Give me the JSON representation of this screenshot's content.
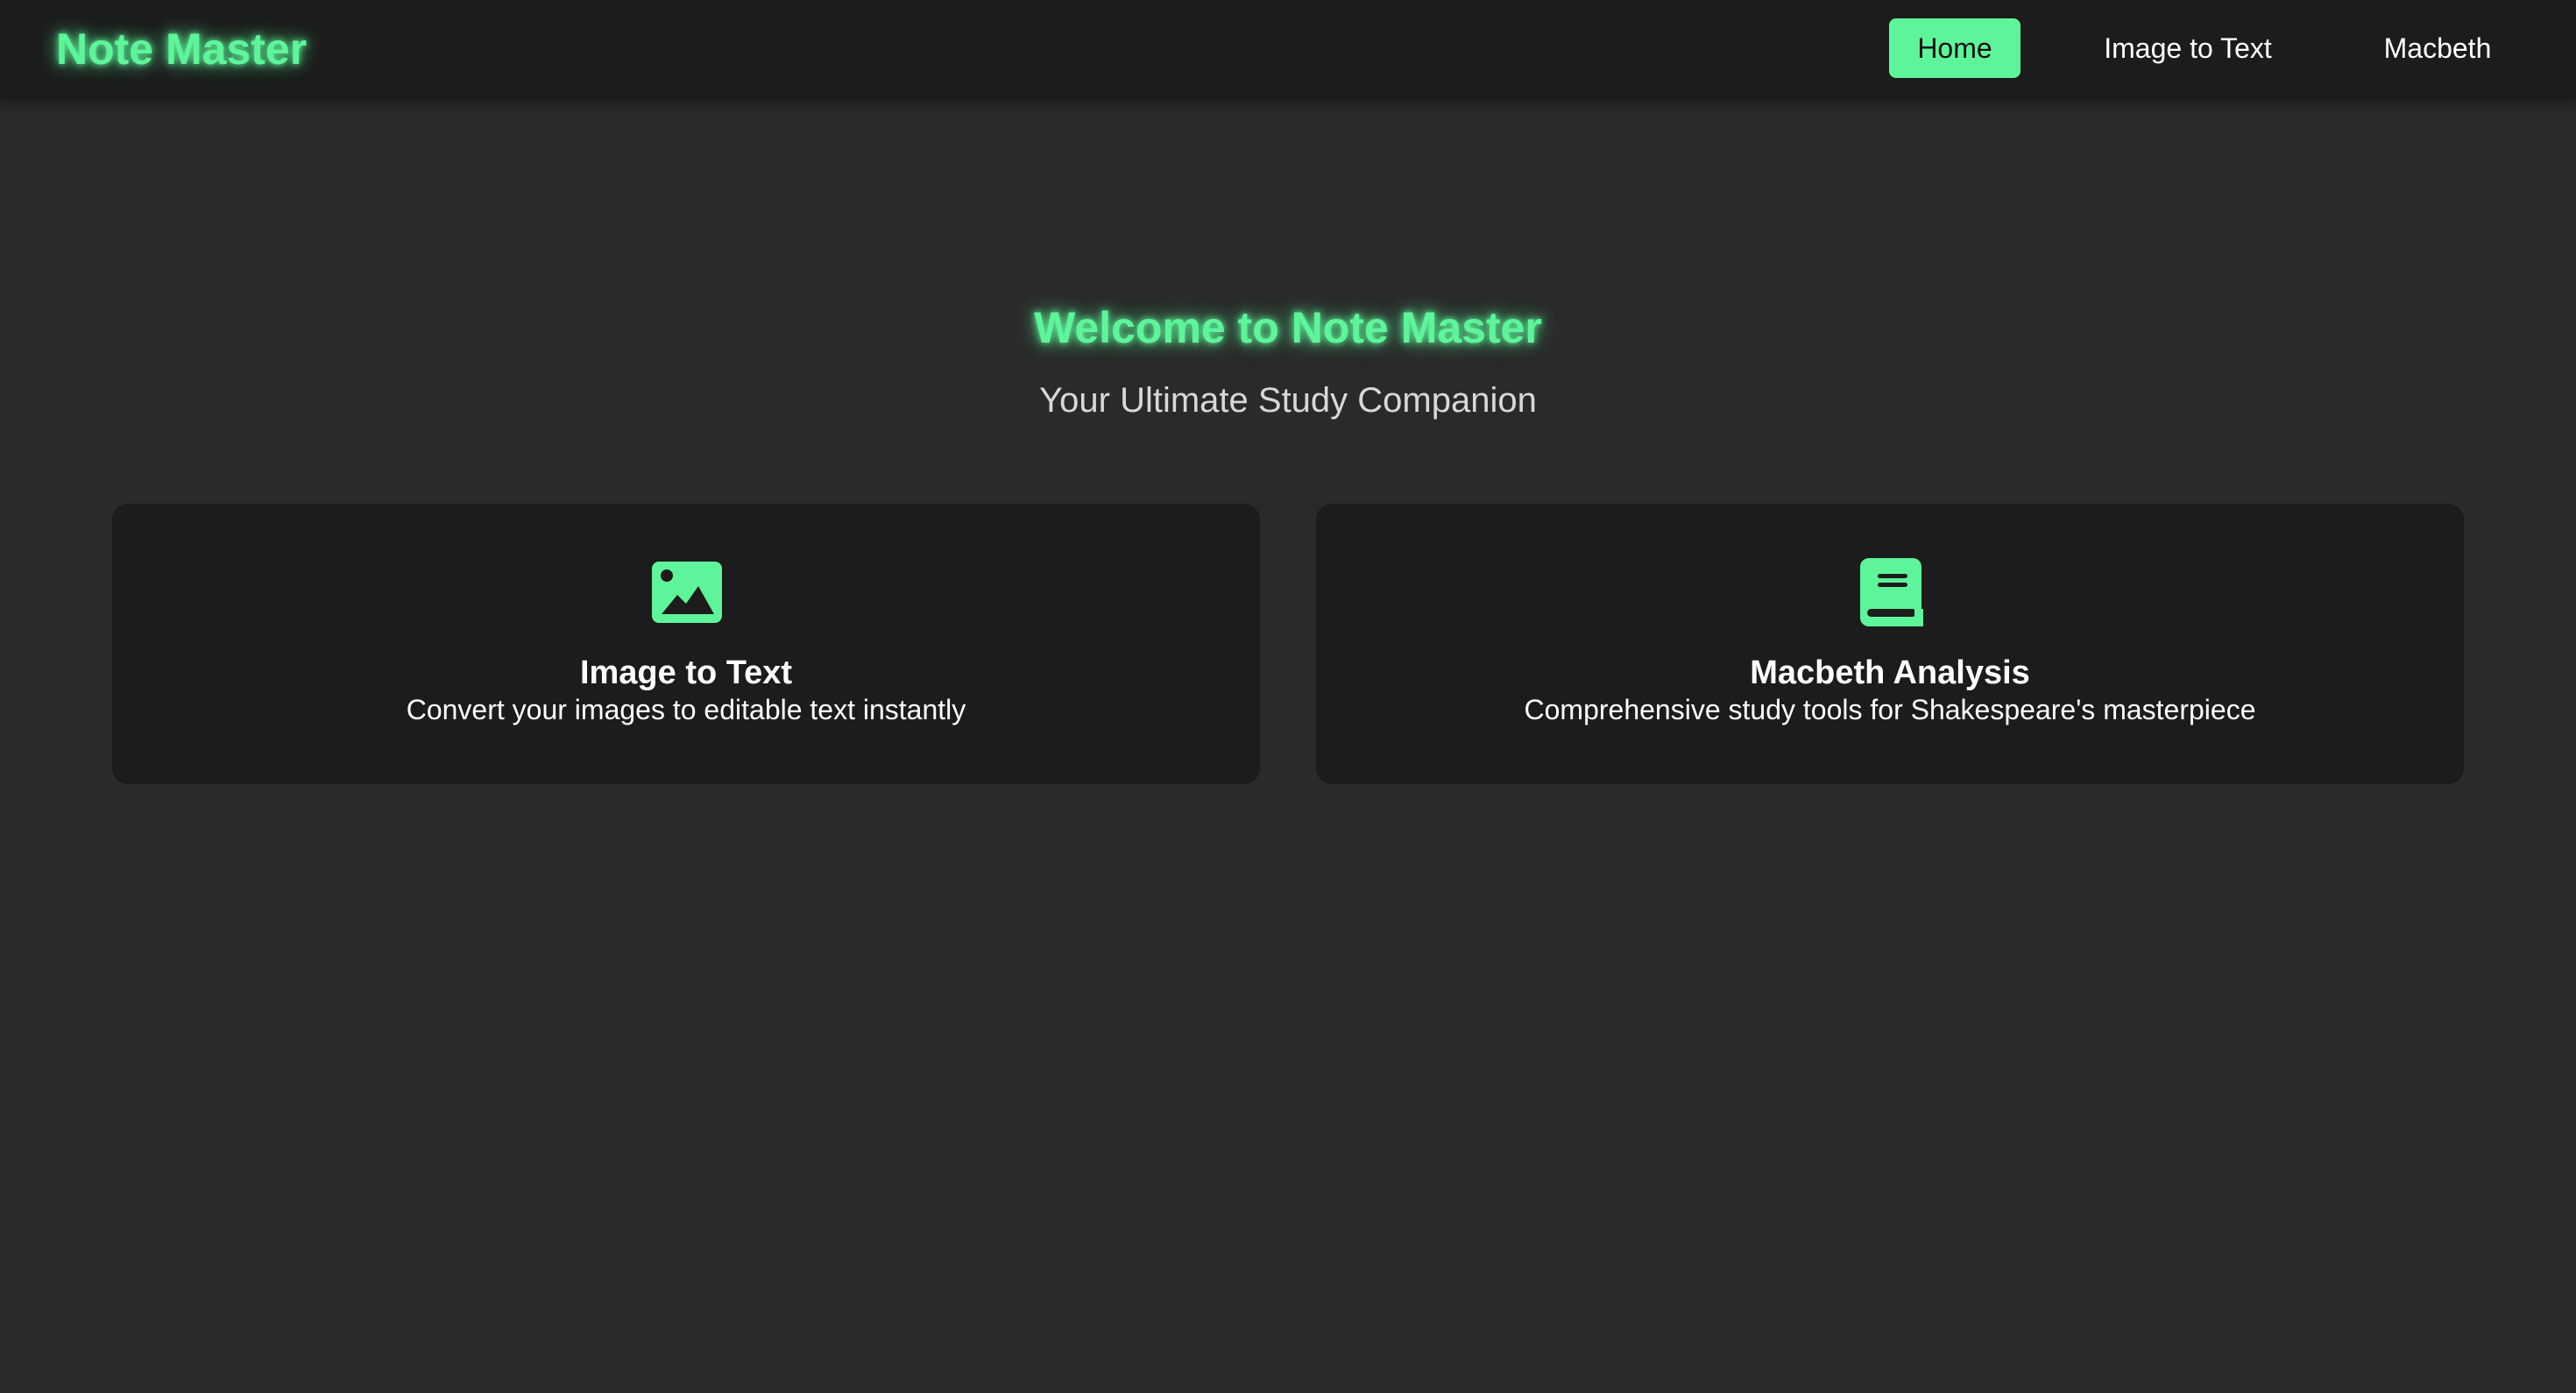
{
  "header": {
    "logo": "Note Master",
    "nav": [
      {
        "label": "Home",
        "active": true
      },
      {
        "label": "Image to Text",
        "active": false
      },
      {
        "label": "Macbeth",
        "active": false
      }
    ]
  },
  "hero": {
    "title": "Welcome to Note Master",
    "subtitle": "Your Ultimate Study Companion"
  },
  "cards": [
    {
      "icon": "image-icon",
      "title": "Image to Text",
      "description": "Convert your images to editable text instantly"
    },
    {
      "icon": "book-icon",
      "title": "Macbeth Analysis",
      "description": "Comprehensive study tools for Shakespeare's masterpiece"
    }
  ],
  "colors": {
    "accent": "#5ef59a",
    "background": "#2a2a2a",
    "surface": "#1c1c1c",
    "text": "#ffffff"
  }
}
